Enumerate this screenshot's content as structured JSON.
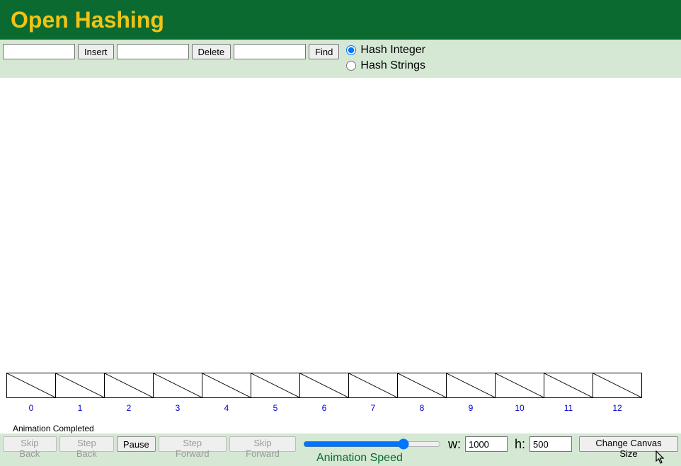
{
  "header": {
    "title": "Open Hashing"
  },
  "controls": {
    "insert_value": "",
    "insert_label": "Insert",
    "delete_value": "",
    "delete_label": "Delete",
    "find_value": "",
    "find_label": "Find",
    "hash_integer_label": "Hash Integer",
    "hash_strings_label": "Hash Strings",
    "hash_mode": "integer"
  },
  "canvas": {
    "table_size": 13,
    "indices": [
      "0",
      "1",
      "2",
      "3",
      "4",
      "5",
      "6",
      "7",
      "8",
      "9",
      "10",
      "11",
      "12"
    ],
    "status": "Animation Completed"
  },
  "footer": {
    "skip_back_label": "Skip Back",
    "step_back_label": "Step Back",
    "pause_label": "Pause",
    "step_forward_label": "Step Forward",
    "skip_forward_label": "Skip Forward",
    "speed_value": "75",
    "width_label": "w:",
    "width_value": "1000",
    "height_label": "h:",
    "height_value": "500",
    "change_size_label": "Change Canvas Size",
    "animation_speed_label": "Animation Speed"
  }
}
